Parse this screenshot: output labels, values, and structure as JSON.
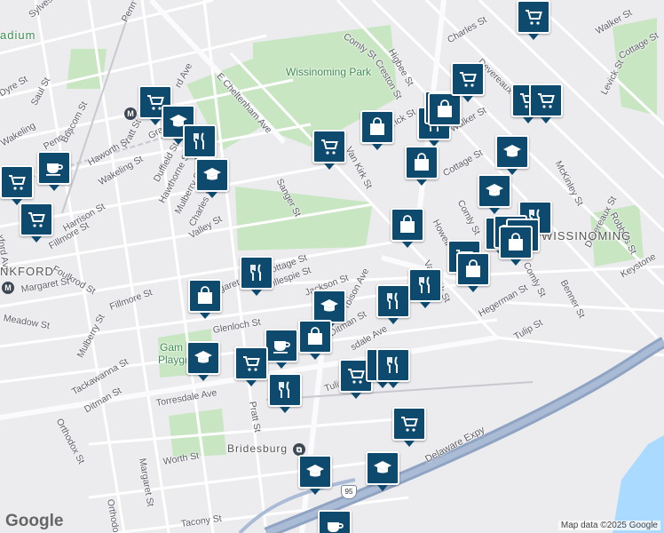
{
  "map": {
    "places": {
      "wissinoming_park": "Wissinoming Park",
      "bridesburg": "Bridesburg",
      "wissinoming": "WISSINOMING",
      "frankford": "NKFORD",
      "stadium": "adium",
      "gambrel": "Gam",
      "playground": "Playgr"
    },
    "streets": {
      "penn_top": "Penn St",
      "sylvester": "Sylves",
      "comly_top": "Comly St",
      "higbee": "Higbee St",
      "creston": "Creston St",
      "charles_top": "Charles St",
      "devereaux": "Devereaux St",
      "walker_top": "Walker St",
      "cottage_right": "Cottage St",
      "levick": "Levick St",
      "e_cheltenham": "E Cheltenham Ave",
      "rd_ave": "rd Ave",
      "dyre": "Dyre St",
      "saul": "Saul St",
      "penn_left": "Penn St",
      "wakeling_left": "Wakeling",
      "briscom": "Briscom St",
      "granite": "Granite St",
      "pratt_left": "Pratt St",
      "haworth": "Haworth St",
      "wakeling": "Wakeling St",
      "harrison": "Harrison St",
      "fillmore": "Fillmore St",
      "foulkrod": "Foulkrod St",
      "margaret": "Margaret St",
      "meadow": "Meadow St",
      "duffield": "Duffield St",
      "hawthorne": "Hawthorne St",
      "mulberry": "Mulberry St",
      "charles_mid": "Charles St",
      "valley": "Valley St",
      "sanger": "Sanger St",
      "van_kirk": "Van Kirk St",
      "kirk": "rick St",
      "walker_mid": "Walker St",
      "cottage_mid": "Cottage St",
      "howell": "Howell St",
      "comly_mid": "Comly St",
      "mckinley": "McKinley St",
      "robbins": "Robbins St",
      "devereaux_right": "Devereaux St",
      "keystone": "Keystone",
      "benner": "Benner St",
      "comly_right": "Comly St",
      "hegerman": "Hegerman St",
      "tulip_right": "Tulip St",
      "cottage_small": "ottage St",
      "gillespie": "Gillespie St",
      "jackson": "Jackson St",
      "orbison": "rbison Ave",
      "van_kirk_2": "Van Kirk St",
      "ditman_mid": "Ditman St",
      "glenloch": "Glenloch St",
      "fillmore_mid": "Fillmore St",
      "margaret_mid": "Margaret St",
      "mulberry_low": "Mulberry St",
      "tackawanna": "Tackawanna St",
      "ditman_low": "Ditman St",
      "torresdale": "Torresdale Ave",
      "torresdale_mid": "sdale Ave",
      "tulip_mid": "Tulip",
      "pratt_low": "Pratt St",
      "orthodox": "Orthodox St",
      "orthodox_low": "Orthodo",
      "margaret_low": "Margaret St",
      "worth": "Worth St",
      "tacony": "Tacony St",
      "delaware": "Delaware Expy",
      "xford": "xford Ave",
      "ha": "Ha",
      "om_st": "om St",
      "on_ave": "on Ave"
    },
    "highway_shield": "95",
    "metro_letter": "M",
    "rail_icon": "rail-station-icon"
  },
  "pins": [
    {
      "type": "shopping-cart-icon",
      "label": "grocery"
    },
    {
      "type": "graduation-cap-icon",
      "label": "school"
    },
    {
      "type": "fork-knife-icon",
      "label": "restaurant"
    },
    {
      "type": "coffee-cup-icon",
      "label": "cafe"
    },
    {
      "type": "shopping-bag-icon",
      "label": "shop"
    }
  ],
  "footer": {
    "logo": "Google",
    "attribution": "Map data ©2025 Google"
  },
  "colors": {
    "pin": "#0d4a6e",
    "park": "#c9e6c3",
    "water": "#aadaff",
    "highway": "#8fa3c2",
    "land": "#ececef"
  }
}
